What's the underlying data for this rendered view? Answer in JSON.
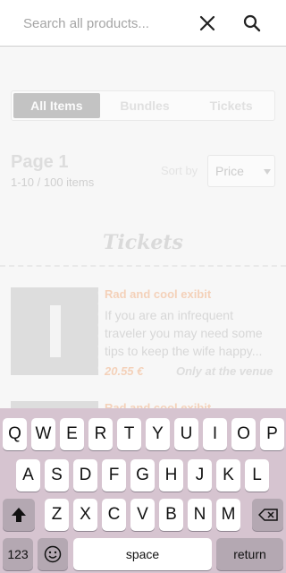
{
  "search": {
    "placeholder": "Search all products...",
    "value": ""
  },
  "icons": {
    "close": "close-icon",
    "search": "search-icon"
  },
  "tabs": [
    {
      "label": "All Items",
      "active": true
    },
    {
      "label": "Bundles",
      "active": false
    },
    {
      "label": "Tickets",
      "active": false
    }
  ],
  "pagination": {
    "title": "Page 1",
    "summary": "1-10 / 100 items"
  },
  "sort": {
    "label": "Sort by",
    "selected": "Price"
  },
  "section": {
    "title": "Tickets"
  },
  "products": [
    {
      "title": "Rad and cool exibit",
      "description": "If you are an infrequent traveler you may need some tips to keep the wife happy...",
      "price": "20.55 €",
      "note": "Only at the venue"
    },
    {
      "title": "Rad and cool exibit"
    }
  ],
  "keyboard": {
    "row1": [
      "Q",
      "W",
      "E",
      "R",
      "T",
      "Y",
      "U",
      "I",
      "O",
      "P"
    ],
    "row2": [
      "A",
      "S",
      "D",
      "F",
      "G",
      "H",
      "J",
      "K",
      "L"
    ],
    "row3": [
      "Z",
      "X",
      "C",
      "V",
      "B",
      "N",
      "M"
    ],
    "numbers_label": "123",
    "space_label": "space",
    "return_label": "return"
  },
  "colors": {
    "accent": "#f2b388",
    "keyboard_bg": "#d6c4d0"
  }
}
